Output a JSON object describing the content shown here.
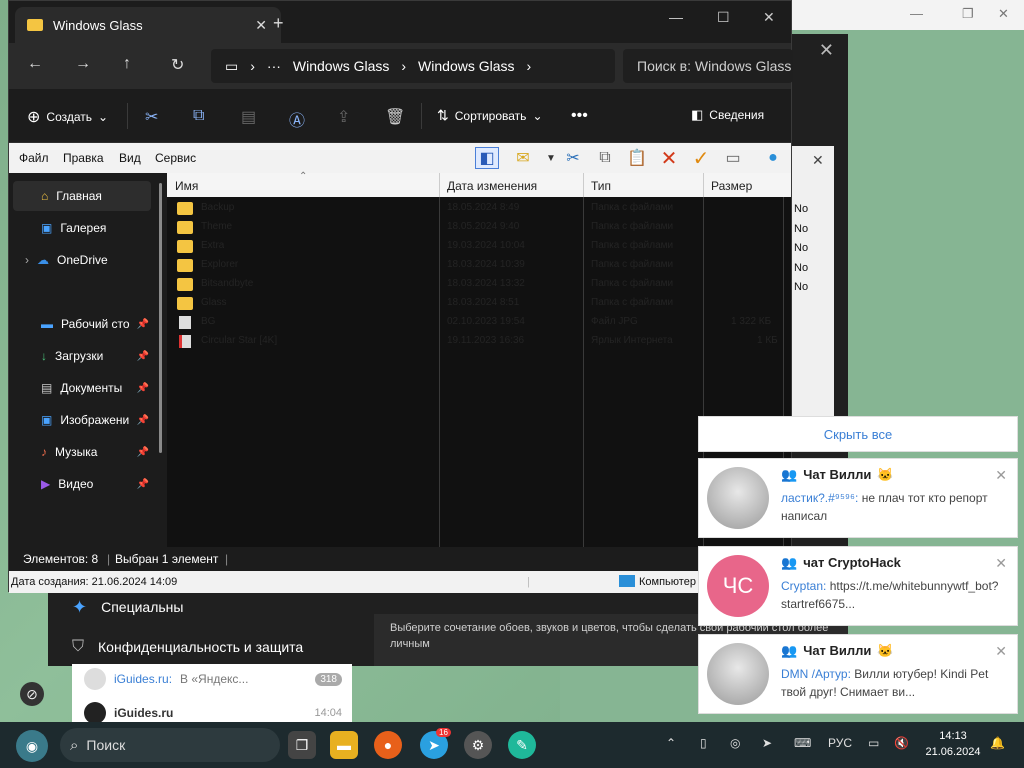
{
  "explorer": {
    "tab_title": "Windows Glass",
    "breadcrumb": [
      "Windows Glass",
      "Windows Glass"
    ],
    "search_placeholder": "Поиск в: Windows Glass",
    "commands": {
      "create": "Создать",
      "sort": "Сортировать",
      "details": "Сведения"
    },
    "menu": [
      "Файл",
      "Правка",
      "Вид",
      "Сервис"
    ],
    "sidebar": [
      {
        "label": "Главная",
        "icon": "home-icon"
      },
      {
        "label": "Галерея",
        "icon": "gallery-icon"
      },
      {
        "label": "OneDrive",
        "icon": "cloud-icon"
      },
      {
        "label": "Рабочий сто",
        "icon": "desktop-icon"
      },
      {
        "label": "Загрузки",
        "icon": "download-icon"
      },
      {
        "label": "Документы",
        "icon": "documents-icon"
      },
      {
        "label": "Изображени",
        "icon": "pictures-icon"
      },
      {
        "label": "Музыка",
        "icon": "music-icon"
      },
      {
        "label": "Видео",
        "icon": "video-icon"
      }
    ],
    "columns": {
      "name": "Имя",
      "date": "Дата изменения",
      "type": "Тип",
      "size": "Размер"
    },
    "files": [
      {
        "name": "Backup",
        "date": "18.05.2024 8:49",
        "type": "Папка с файлами",
        "size": "",
        "kind": "folder"
      },
      {
        "name": "Theme",
        "date": "18.05.2024 9:40",
        "type": "Папка с файлами",
        "size": "",
        "kind": "folder"
      },
      {
        "name": "Extra",
        "date": "19.03.2024 10:04",
        "type": "Папка с файлами",
        "size": "",
        "kind": "folder"
      },
      {
        "name": "Explorer",
        "date": "18.03.2024 10:39",
        "type": "Папка с файлами",
        "size": "",
        "kind": "folder"
      },
      {
        "name": "Bitsandbyte",
        "date": "18.03.2024 13:32",
        "type": "Папка с файлами",
        "size": "",
        "kind": "folder"
      },
      {
        "name": "Glass",
        "date": "18.03.2024 8:51",
        "type": "Папка с файлами",
        "size": "",
        "kind": "folder"
      },
      {
        "name": "BG",
        "date": "02.10.2023 19:54",
        "type": "Файл JPG",
        "size": "1 322 КБ",
        "kind": "image"
      },
      {
        "name": "Circular Star [4K]",
        "date": "19.11.2023 16:36",
        "type": "Ярлык Интернета",
        "size": "1 КБ",
        "kind": "link"
      }
    ],
    "status": {
      "items": "Элементов: 8",
      "selected": "Выбран 1 элемент"
    },
    "info": {
      "created": "Дата создания: 21.06.2024 14:09",
      "computer": "Компьютер"
    }
  },
  "settings": {
    "items": [
      "Специальны",
      "Конфиденциальность и защита"
    ],
    "description": "Выберите сочетание обоев, звуков и цветов, чтобы сделать свой рабочий стол более личным"
  },
  "dialog": {
    "rows": [
      "No",
      "No",
      "No",
      "No",
      "No"
    ]
  },
  "chatlist": [
    {
      "name": "iGuides.ru:",
      "preview": "В «Яндекс...",
      "badge": "318"
    },
    {
      "name": "iGuides.ru",
      "time": "14:04"
    }
  ],
  "notifications": {
    "hide_all": "Скрыть все",
    "items": [
      {
        "title": "Чат Вилли",
        "emoji": "🐱",
        "sender": "ластик?.#⁹⁵⁹⁶:",
        "text": "не плач тот кто репорт написал",
        "avatar_color": "#b8b8b8"
      },
      {
        "title": "чат CryptoHack",
        "emoji": "",
        "sender": "Cryptan:",
        "text": "https://t.me/whitebunnywtf_bot?startref6675...",
        "avatar_text": "ЧС",
        "avatar_color": "#e8668a"
      },
      {
        "title": "Чат Вилли",
        "emoji": "🐱",
        "sender": "DMN /Артур:",
        "text": "Вилли ютубер! Kindi Pet твой друг! Снимает ви...",
        "avatar_color": "#b8b8b8"
      }
    ]
  },
  "taskbar": {
    "search": "Поиск",
    "telegram_badge": "16",
    "lang": "РУС",
    "time": "14:13",
    "date": "21.06.2024"
  },
  "colors": {
    "accent": "#3a7fd5",
    "folder": "#f4c542",
    "dark": "#1c1c1c"
  }
}
